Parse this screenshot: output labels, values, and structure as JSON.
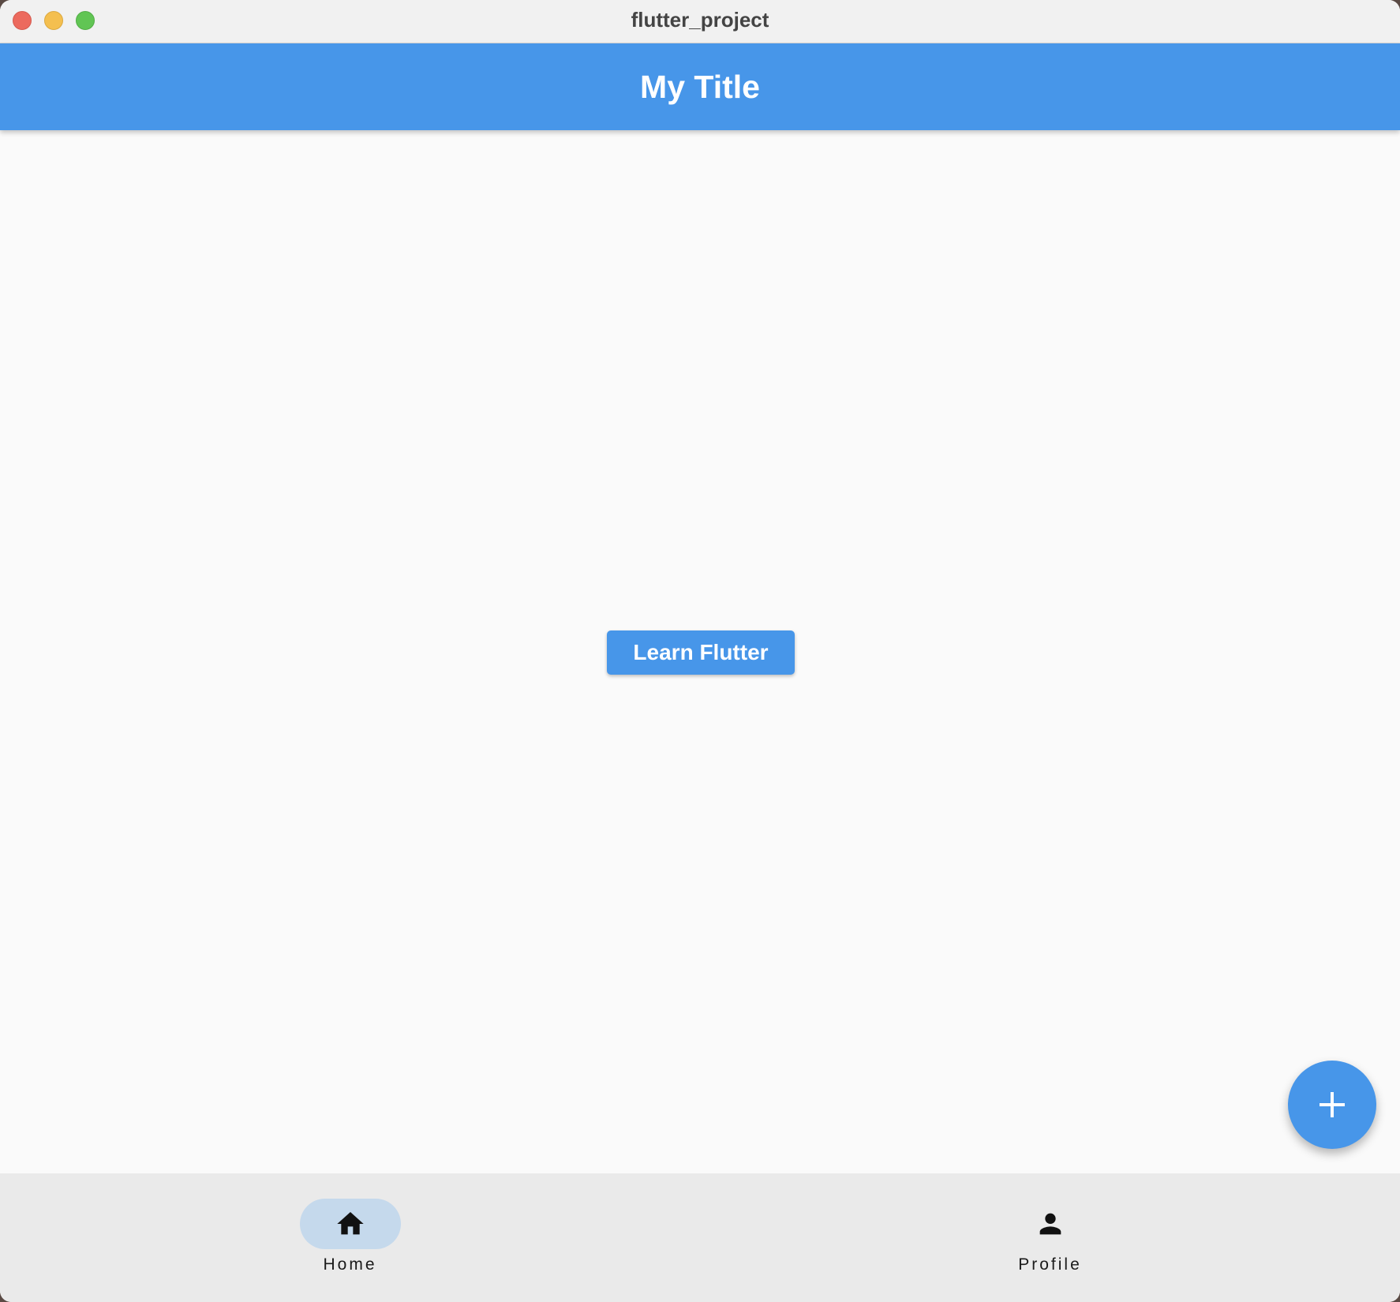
{
  "window": {
    "title": "flutter_project"
  },
  "appbar": {
    "title": "My Title"
  },
  "main": {
    "primary_button_label": "Learn Flutter"
  },
  "fab": {
    "icon": "plus-icon"
  },
  "bottom_nav": {
    "items": [
      {
        "label": "Home",
        "icon": "home-icon",
        "selected": true
      },
      {
        "label": "Profile",
        "icon": "person-icon",
        "selected": false
      }
    ]
  },
  "colors": {
    "primary": "#4796e9",
    "nav_background": "#eaeaea",
    "nav_indicator": "#c5d9ec",
    "page_background": "#fafafa"
  }
}
